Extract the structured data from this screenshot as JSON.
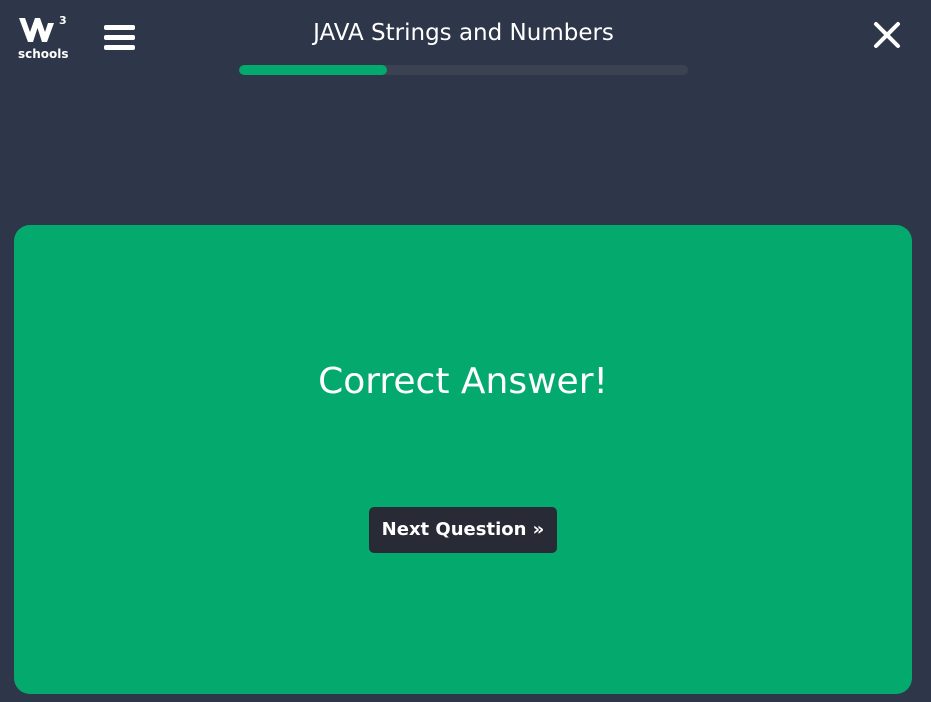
{
  "header": {
    "logo_text": "schools",
    "logo_superscript": "3",
    "menu_icon": "hamburger-menu-icon",
    "title": "JAVA Strings and Numbers",
    "progress_percent": 33,
    "close_icon": "close-icon"
  },
  "result": {
    "message": "Correct Answer!",
    "next_button_label": "Next Question »"
  },
  "colors": {
    "background": "#2e3649",
    "accent": "#04aa6d",
    "progress_track": "#3b4352",
    "button": "#282a35",
    "text": "#ffffff"
  }
}
